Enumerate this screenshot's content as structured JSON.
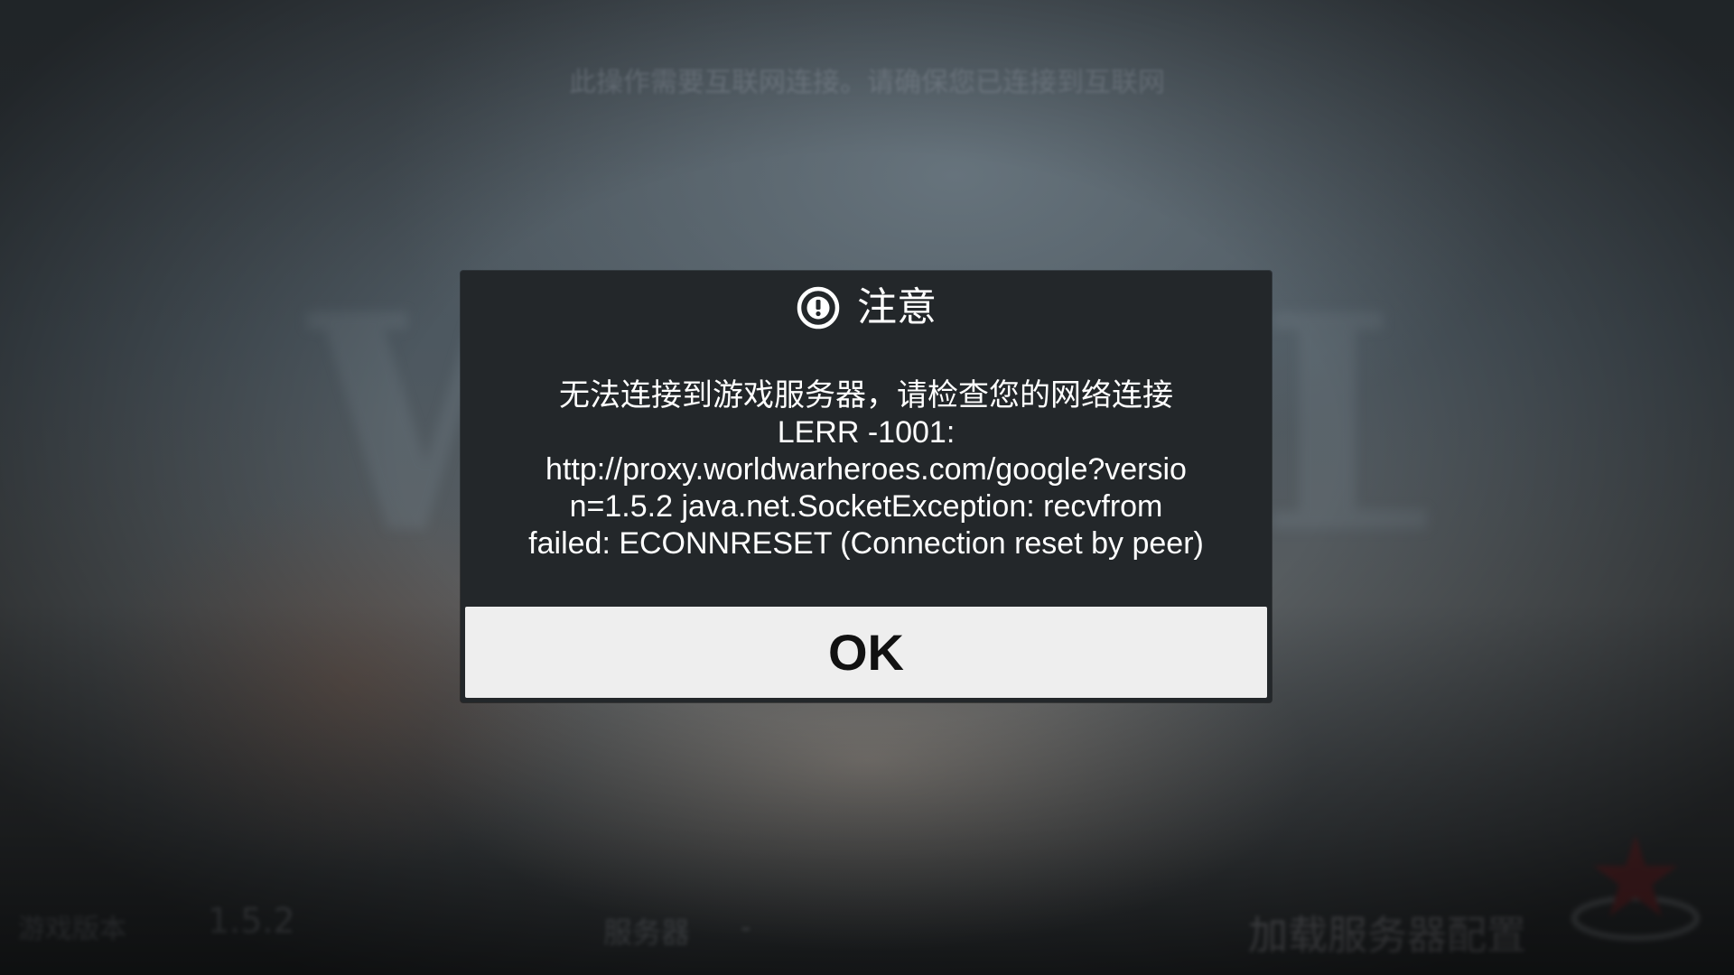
{
  "background": {
    "notice": "此操作需要互联网连接。请确保您已连接到互联网",
    "logo_text": "WORLD WAR",
    "version_label": "游戏版本",
    "version_value": "1.5.2",
    "server_label": "服务器",
    "server_value": "-",
    "loading_text": "加载服务器配置"
  },
  "dialog": {
    "icon": "exclamation-circle-icon",
    "title": "注意",
    "message_lines": [
      "无法连接到游戏服务器，请检查您的网络连接",
      "LERR -1001:",
      "http://proxy.worldwarheroes.com/google?versio",
      "n=1.5.2 java.net.SocketException: recvfrom",
      "failed: ECONNRESET (Connection reset by peer)"
    ],
    "ok_label": "OK"
  },
  "colors": {
    "dialog_background": "#23272a",
    "button_background": "#eeeeee",
    "button_text": "#111111",
    "dialog_text": "#ffffff"
  }
}
